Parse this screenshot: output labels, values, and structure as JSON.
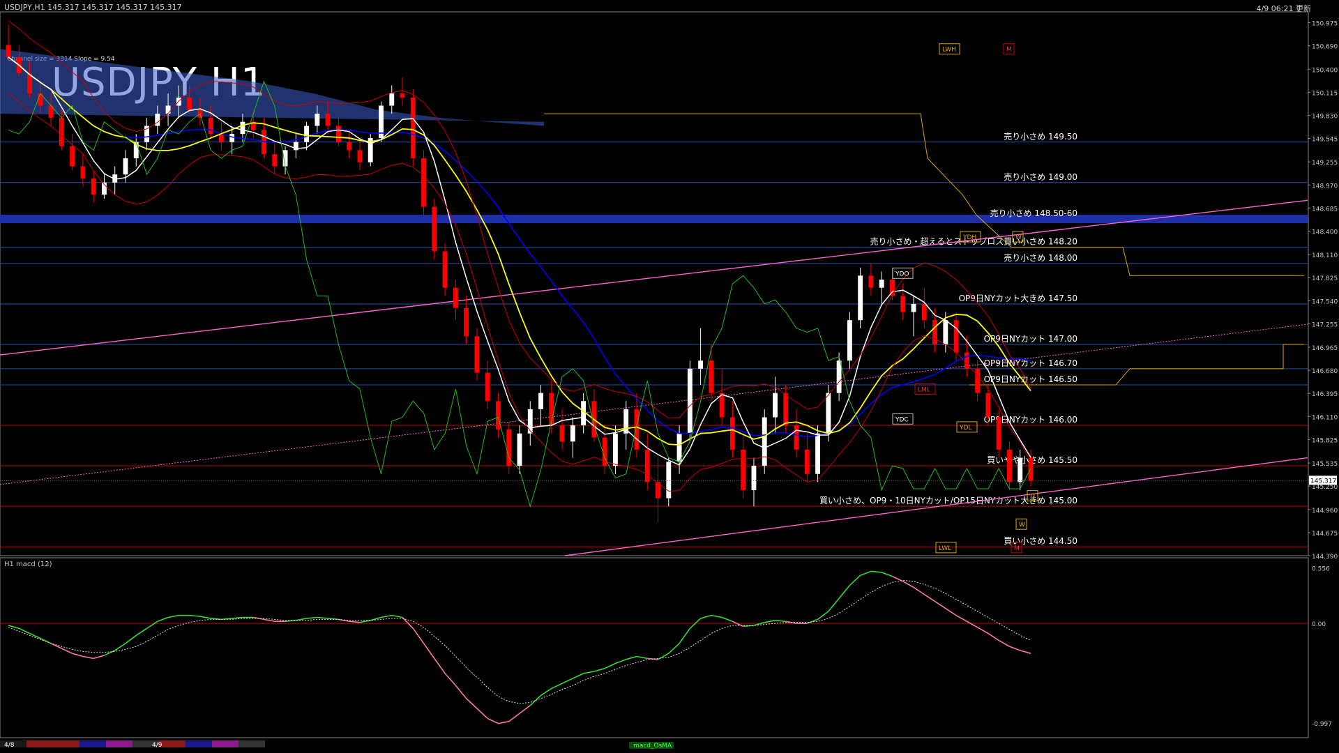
{
  "header": {
    "symbol_info": "USDJPY,H1  145.317 145.317 145.317 145.317",
    "datetime": "4/9 06:21 更新",
    "channel_info": "Channel size = 3314 Slope = 9.54",
    "big_title": "USDJPY H1"
  },
  "colors": {
    "background": "#000000",
    "grid_line": "#2a4ea8",
    "red_line": "#c00000",
    "price_line": "#d9d9d9",
    "ichimoku_cloud": "#3a5cc8",
    "magenta_trend": "#ff66cc",
    "bull_candle": "#ffffff",
    "bear_candle": "#ff0000",
    "sma_white": "#ffffff",
    "sma_yellow": "#ffff00",
    "sma_blue": "#0000ff",
    "chikou_green": "#22bb22",
    "kijun_red": "#cc0000",
    "macd_green": "#33dd33",
    "macd_pink": "#ff77aa",
    "signal_dotted": "#dddddd",
    "level_orange": "#ddaa00"
  },
  "chart_data": {
    "type": "candlestick",
    "title": "USDJPY H1",
    "y_axis_ticks": [
      "150.975",
      "150.690",
      "150.400",
      "150.115",
      "149.830",
      "149.545",
      "149.255",
      "148.970",
      "148.685",
      "148.400",
      "148.110",
      "147.825",
      "147.540",
      "147.255",
      "146.965",
      "146.680",
      "146.395",
      "146.110",
      "145.825",
      "145.535",
      "145.250",
      "144.960",
      "144.675",
      "144.390"
    ],
    "ylim": [
      144.39,
      151.1
    ],
    "current_price": "145.317",
    "levels": [
      {
        "price": 149.5,
        "label": "売り小さめ 149.50",
        "color": "blue"
      },
      {
        "price": 149.0,
        "label": "売り小さめ 149.00",
        "color": "blue"
      },
      {
        "price": 148.55,
        "label": "売り小さめ 148.50-60",
        "color": "blue-band"
      },
      {
        "price": 148.2,
        "label": "売り小さめ・超えるとストップロス買い小さめ 148.20",
        "color": "blue"
      },
      {
        "price": 148.0,
        "label": "売り小さめ 148.00",
        "color": "blue"
      },
      {
        "price": 147.5,
        "label": "OP9日NYカット大きめ 147.50",
        "color": "blue"
      },
      {
        "price": 147.0,
        "label": "OP9日NYカット 147.00",
        "color": "blue"
      },
      {
        "price": 146.7,
        "label": "OP9日NYカット 146.70",
        "color": "blue"
      },
      {
        "price": 146.5,
        "label": "OP9日NYカット 146.50",
        "color": "blue"
      },
      {
        "price": 146.0,
        "label": "OP9日NYカット 146.00",
        "color": "red"
      },
      {
        "price": 145.5,
        "label": "買いやや小さめ 145.50",
        "color": "red"
      },
      {
        "price": 145.0,
        "label": "買い小さめ、OP9・10日NYカット/OP15日NYカット大きめ 145.00",
        "color": "red"
      },
      {
        "price": 144.5,
        "label": "買い小さめ 144.50",
        "color": "red"
      }
    ],
    "level_tags": [
      "LWH",
      "M",
      "YDH",
      "YDO",
      "YDC",
      "LML",
      "YDL",
      "LWL",
      "D",
      "W",
      "M",
      "W"
    ],
    "candles": {
      "fields": [
        "open",
        "high",
        "low",
        "close"
      ],
      "values": [
        [
          150.7,
          150.95,
          150.5,
          150.55
        ],
        [
          150.55,
          150.7,
          150.3,
          150.35
        ],
        [
          150.35,
          150.5,
          150.05,
          150.1
        ],
        [
          150.1,
          150.25,
          149.85,
          149.95
        ],
        [
          149.95,
          150.1,
          149.7,
          149.8
        ],
        [
          149.8,
          149.9,
          149.4,
          149.45
        ],
        [
          149.45,
          149.6,
          149.15,
          149.2
        ],
        [
          149.2,
          149.35,
          148.95,
          149.05
        ],
        [
          149.05,
          149.15,
          148.75,
          148.85
        ],
        [
          148.85,
          149.1,
          148.8,
          149.0
        ],
        [
          149.0,
          149.2,
          148.85,
          149.1
        ],
        [
          149.1,
          149.4,
          149.0,
          149.3
        ],
        [
          149.3,
          149.6,
          149.2,
          149.5
        ],
        [
          149.5,
          149.8,
          149.4,
          149.7
        ],
        [
          149.7,
          149.95,
          149.6,
          149.85
        ],
        [
          149.85,
          150.1,
          149.7,
          149.95
        ],
        [
          149.95,
          150.2,
          149.8,
          150.05
        ],
        [
          150.05,
          150.2,
          149.85,
          149.9
        ],
        [
          149.9,
          150.05,
          149.7,
          149.8
        ],
        [
          149.8,
          149.95,
          149.55,
          149.6
        ],
        [
          149.6,
          149.75,
          149.4,
          149.5
        ],
        [
          149.5,
          149.7,
          149.35,
          149.6
        ],
        [
          149.6,
          149.85,
          149.5,
          149.75
        ],
        [
          149.75,
          149.9,
          149.55,
          149.65
        ],
        [
          149.65,
          149.8,
          149.3,
          149.35
        ],
        [
          149.35,
          149.5,
          149.1,
          149.2
        ],
        [
          149.2,
          149.45,
          149.1,
          149.4
        ],
        [
          149.4,
          149.6,
          149.3,
          149.5
        ],
        [
          149.5,
          149.75,
          149.4,
          149.7
        ],
        [
          149.7,
          149.95,
          149.6,
          149.85
        ],
        [
          149.85,
          150.0,
          149.6,
          149.7
        ],
        [
          149.7,
          149.8,
          149.45,
          149.5
        ],
        [
          149.5,
          149.65,
          149.3,
          149.4
        ],
        [
          149.4,
          149.55,
          149.15,
          149.25
        ],
        [
          149.25,
          149.6,
          149.2,
          149.55
        ],
        [
          149.55,
          150.0,
          149.5,
          149.95
        ],
        [
          149.95,
          150.2,
          149.85,
          150.1
        ],
        [
          150.1,
          150.3,
          149.95,
          150.05
        ],
        [
          150.05,
          150.15,
          149.2,
          149.3
        ],
        [
          149.3,
          149.4,
          148.6,
          148.7
        ],
        [
          148.7,
          148.8,
          148.05,
          148.15
        ],
        [
          148.15,
          148.25,
          147.6,
          147.7
        ],
        [
          147.7,
          147.8,
          147.3,
          147.45
        ],
        [
          147.45,
          147.6,
          147.0,
          147.1
        ],
        [
          147.1,
          147.2,
          146.55,
          146.65
        ],
        [
          146.65,
          146.8,
          146.2,
          146.3
        ],
        [
          146.3,
          146.4,
          145.85,
          145.95
        ],
        [
          145.95,
          146.05,
          145.4,
          145.5
        ],
        [
          145.5,
          146.0,
          145.4,
          145.9
        ],
        [
          145.9,
          146.3,
          145.75,
          146.2
        ],
        [
          146.2,
          146.5,
          146.0,
          146.4
        ],
        [
          146.4,
          146.55,
          145.9,
          146.0
        ],
        [
          146.0,
          146.2,
          145.7,
          145.8
        ],
        [
          145.8,
          146.1,
          145.6,
          146.0
        ],
        [
          146.0,
          146.4,
          145.9,
          146.3
        ],
        [
          146.3,
          146.45,
          145.8,
          145.85
        ],
        [
          145.85,
          146.0,
          145.4,
          145.5
        ],
        [
          145.5,
          146.0,
          145.4,
          145.9
        ],
        [
          145.9,
          146.3,
          145.7,
          146.2
        ],
        [
          146.2,
          146.4,
          145.6,
          145.7
        ],
        [
          145.7,
          145.9,
          145.2,
          145.3
        ],
        [
          145.3,
          145.6,
          144.8,
          145.1
        ],
        [
          145.1,
          145.6,
          145.0,
          145.55
        ],
        [
          145.55,
          146.0,
          145.4,
          145.9
        ],
        [
          145.9,
          146.8,
          145.8,
          146.7
        ],
        [
          146.7,
          147.2,
          146.5,
          146.8
        ],
        [
          146.8,
          147.0,
          146.3,
          146.4
        ],
        [
          146.4,
          146.7,
          146.0,
          146.1
        ],
        [
          146.1,
          146.3,
          145.6,
          145.7
        ],
        [
          145.7,
          145.9,
          145.1,
          145.2
        ],
        [
          145.2,
          145.6,
          145.0,
          145.5
        ],
        [
          145.5,
          146.2,
          145.4,
          146.1
        ],
        [
          146.1,
          146.6,
          145.9,
          146.4
        ],
        [
          146.4,
          146.5,
          145.9,
          146.0
        ],
        [
          146.0,
          146.2,
          145.6,
          145.7
        ],
        [
          145.7,
          145.9,
          145.3,
          145.4
        ],
        [
          145.4,
          146.0,
          145.3,
          145.9
        ],
        [
          145.9,
          146.5,
          145.8,
          146.4
        ],
        [
          146.4,
          146.9,
          146.3,
          146.8
        ],
        [
          146.8,
          147.4,
          146.7,
          147.3
        ],
        [
          147.3,
          147.95,
          147.2,
          147.85
        ],
        [
          147.85,
          148.0,
          147.6,
          147.7
        ],
        [
          147.7,
          147.9,
          147.5,
          147.8
        ],
        [
          147.8,
          147.95,
          147.55,
          147.6
        ],
        [
          147.6,
          147.75,
          147.3,
          147.4
        ],
        [
          147.4,
          147.6,
          147.1,
          147.5
        ],
        [
          147.5,
          147.7,
          147.2,
          147.3
        ],
        [
          147.3,
          147.45,
          146.9,
          147.0
        ],
        [
          147.0,
          147.4,
          146.9,
          147.3
        ],
        [
          147.3,
          147.4,
          146.8,
          146.9
        ],
        [
          146.9,
          147.1,
          146.6,
          146.7
        ],
        [
          146.7,
          146.8,
          146.3,
          146.4
        ],
        [
          146.4,
          146.5,
          146.0,
          146.1
        ],
        [
          146.1,
          146.2,
          145.6,
          145.7
        ],
        [
          145.7,
          145.8,
          145.2,
          145.3
        ],
        [
          145.3,
          145.7,
          145.2,
          145.6
        ],
        [
          145.6,
          145.7,
          145.25,
          145.317
        ]
      ]
    },
    "macd_panel": {
      "label": "H1  macd (12)",
      "ticks": [
        "0.556",
        "0.00",
        "-0.997"
      ],
      "ylim": [
        -1.1,
        0.6
      ],
      "macd": [
        -0.02,
        -0.05,
        -0.1,
        -0.15,
        -0.2,
        -0.25,
        -0.3,
        -0.33,
        -0.35,
        -0.32,
        -0.27,
        -0.2,
        -0.12,
        -0.05,
        0.02,
        0.06,
        0.08,
        0.08,
        0.07,
        0.05,
        0.04,
        0.05,
        0.06,
        0.06,
        0.04,
        0.02,
        0.02,
        0.03,
        0.05,
        0.06,
        0.05,
        0.04,
        0.02,
        0.01,
        0.03,
        0.06,
        0.08,
        0.06,
        -0.05,
        -0.2,
        -0.35,
        -0.5,
        -0.62,
        -0.75,
        -0.85,
        -0.95,
        -1.0,
        -0.98,
        -0.9,
        -0.82,
        -0.72,
        -0.65,
        -0.6,
        -0.55,
        -0.5,
        -0.48,
        -0.45,
        -0.4,
        -0.36,
        -0.33,
        -0.35,
        -0.36,
        -0.3,
        -0.2,
        -0.05,
        0.05,
        0.08,
        0.06,
        0.02,
        -0.03,
        -0.02,
        0.01,
        0.03,
        0.02,
        0.0,
        0.0,
        0.04,
        0.12,
        0.25,
        0.38,
        0.48,
        0.52,
        0.51,
        0.47,
        0.42,
        0.36,
        0.29,
        0.22,
        0.15,
        0.08,
        0.02,
        -0.04,
        -0.1,
        -0.17,
        -0.23,
        -0.27,
        -0.3
      ],
      "signal": [
        -0.04,
        -0.08,
        -0.12,
        -0.16,
        -0.2,
        -0.23,
        -0.26,
        -0.28,
        -0.29,
        -0.29,
        -0.28,
        -0.26,
        -0.23,
        -0.18,
        -0.12,
        -0.06,
        -0.02,
        0.01,
        0.03,
        0.04,
        0.04,
        0.04,
        0.05,
        0.05,
        0.05,
        0.04,
        0.03,
        0.03,
        0.03,
        0.04,
        0.04,
        0.04,
        0.03,
        0.03,
        0.03,
        0.04,
        0.05,
        0.05,
        0.02,
        -0.04,
        -0.13,
        -0.22,
        -0.33,
        -0.44,
        -0.54,
        -0.64,
        -0.73,
        -0.78,
        -0.8,
        -0.79,
        -0.75,
        -0.71,
        -0.66,
        -0.62,
        -0.57,
        -0.53,
        -0.5,
        -0.46,
        -0.42,
        -0.39,
        -0.36,
        -0.35,
        -0.34,
        -0.3,
        -0.24,
        -0.17,
        -0.1,
        -0.05,
        -0.02,
        -0.02,
        -0.02,
        -0.01,
        0.0,
        0.01,
        0.01,
        0.01,
        0.02,
        0.05,
        0.1,
        0.17,
        0.24,
        0.31,
        0.37,
        0.41,
        0.43,
        0.42,
        0.39,
        0.35,
        0.3,
        0.24,
        0.18,
        0.12,
        0.06,
        0.0,
        -0.06,
        -0.12,
        -0.17
      ]
    },
    "time_labels": [
      "4/8",
      "4/9"
    ],
    "footer_tag": "macd_OsMA"
  }
}
